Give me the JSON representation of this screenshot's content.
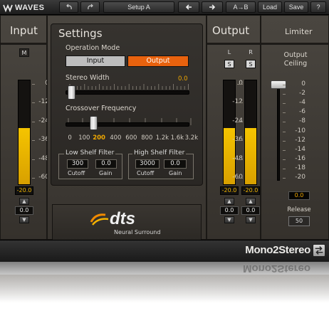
{
  "toolbar": {
    "logo": "WAVES",
    "undo_icon": "undo-icon",
    "redo_icon": "redo-icon",
    "preset": "Setup A",
    "prev_icon": "arrow-left-icon",
    "next_icon": "arrow-right-icon",
    "compare": "A→B",
    "load": "Load",
    "save": "Save",
    "help": "?"
  },
  "input": {
    "title": "Input",
    "channel": "M",
    "peak": "-20.0",
    "value": "0.0",
    "level_fraction": 0.54,
    "scale": [
      "0",
      "-12",
      "-24",
      "-36",
      "-48",
      "-60"
    ]
  },
  "settings": {
    "title": "Settings",
    "operation_mode_label": "Operation Mode",
    "mode_input": "Input",
    "mode_output": "Output",
    "selected_mode": "Output",
    "stereo_width_label": "Stereo Width",
    "stereo_width_value": "0.0",
    "crossover_label": "Crossover Frequency",
    "crossover_freqs": [
      "0",
      "100",
      "200",
      "400",
      "600",
      "800",
      "1.2k",
      "1.6k",
      "3.2k"
    ],
    "crossover_selected": "200",
    "low_shelf": {
      "title": "Low Shelf Filter",
      "cutoff": "300",
      "gain": "0.0",
      "cutoff_label": "Cutoff",
      "gain_label": "Gain"
    },
    "high_shelf": {
      "title": "High Shelf Filter",
      "cutoff": "3000",
      "gain": "0.0",
      "cutoff_label": "Cutoff",
      "gain_label": "Gain"
    }
  },
  "dts": {
    "logo": "dts",
    "subtitle": "Neural Surround"
  },
  "output": {
    "title": "Output",
    "left_label": "L",
    "right_label": "R",
    "solo_left": "S",
    "solo_right": "S",
    "peak_left": "-20.0",
    "peak_right": "-20.0",
    "value_left": "0.0",
    "value_right": "0.0",
    "level_fraction": 0.54,
    "scale": [
      "0",
      "-12",
      "-24",
      "-36",
      "-48",
      "-60"
    ]
  },
  "limiter": {
    "title": "Limiter",
    "ceiling_label_1": "Output",
    "ceiling_label_2": "Ceiling",
    "scale": [
      "0",
      "-2",
      "-4",
      "-6",
      "-8",
      "-10",
      "-12",
      "-14",
      "-16",
      "-18",
      "-20"
    ],
    "ceiling_value": "0.0",
    "release_label": "Release",
    "release_value": "50"
  },
  "footer": {
    "product": "Mono2Stereo",
    "swap_icon": "swap-icon"
  },
  "colors": {
    "meter": "#f0b400",
    "output_button": "#e8620e",
    "accent_text": "#f0a800"
  }
}
